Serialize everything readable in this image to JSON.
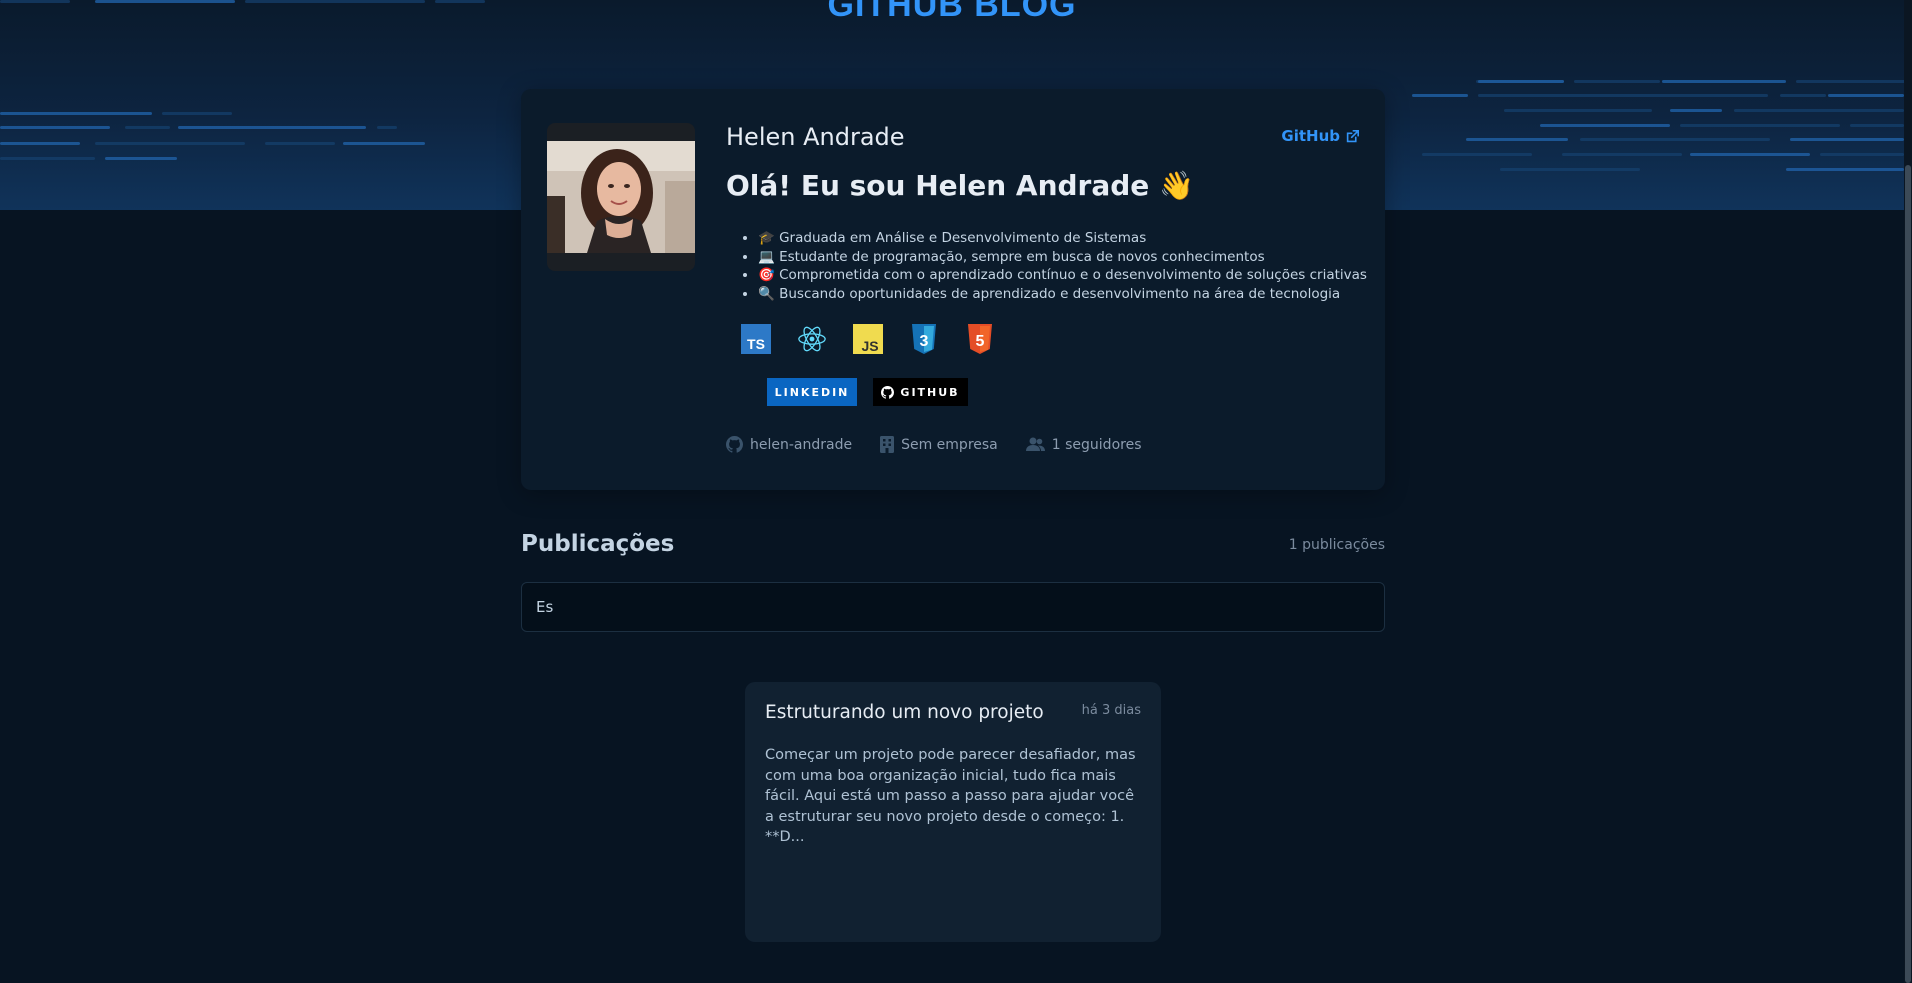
{
  "header": {
    "brand": "GITHUB BLOG"
  },
  "profile": {
    "name": "Helen Andrade",
    "github_link_label": "GitHub",
    "headline": "Olá! Eu sou Helen Andrade 👋",
    "bio": [
      "🎓 Graduada em Análise e Desenvolvimento de Sistemas",
      "💻 Estudante de programação, sempre em busca de novos conhecimentos",
      "🎯 Comprometida com o aprendizado contínuo e o desenvolvimento de soluções criativas",
      "🔍 Buscando oportunidades de aprendizado e desenvolvimento na área de tecnologia"
    ],
    "techs": [
      {
        "label": "TS",
        "icon": "typescript-icon"
      },
      {
        "label": "",
        "icon": "react-icon"
      },
      {
        "label": "JS",
        "icon": "javascript-icon"
      },
      {
        "label": "3",
        "icon": "css3-icon"
      },
      {
        "label": "5",
        "icon": "html5-icon"
      }
    ],
    "socials": {
      "linkedin": "LINKEDIN",
      "github": "GITHUB"
    },
    "info": {
      "username": "helen-andrade",
      "company": "Sem empresa",
      "followers": "1 seguidores"
    }
  },
  "publications": {
    "title": "Publicações",
    "count": "1 publicações",
    "search_value": "Es",
    "posts": [
      {
        "title": "Estruturando um novo projeto",
        "date": "há 3 dias",
        "excerpt": "Começar um projeto pode parecer desafiador, mas com uma boa organização inicial, tudo fica mais fácil. Aqui está um passo a passo para ajudar você a estruturar seu novo projeto desde o começo: 1. **D..."
      }
    ]
  },
  "colors": {
    "accent": "#3294f8",
    "background": "#071422",
    "card": "#0b1b2b",
    "post_card": "#112131"
  }
}
